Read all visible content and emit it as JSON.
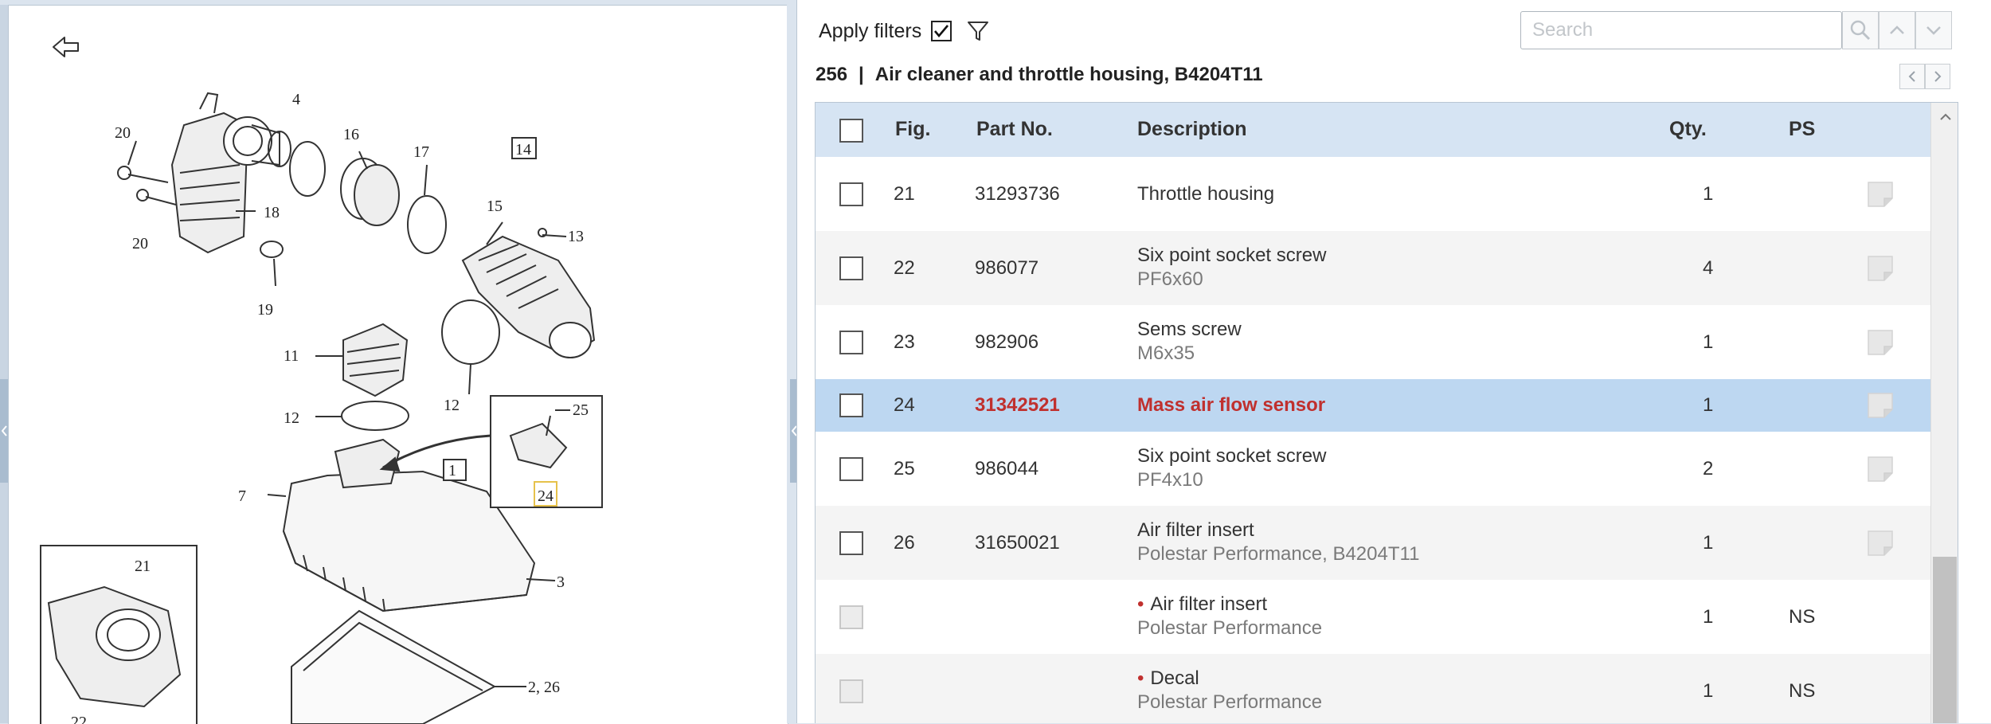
{
  "filters": {
    "label": "Apply filters",
    "checked": true
  },
  "search": {
    "placeholder": "Search"
  },
  "section": {
    "number": "256",
    "separator": "|",
    "title": "Air cleaner and throttle housing, B4204T11"
  },
  "table": {
    "headers": {
      "fig": "Fig.",
      "part_no": "Part No.",
      "description": "Description",
      "qty": "Qty.",
      "ps": "PS"
    },
    "rows": [
      {
        "fig": "21",
        "part_no": "31293736",
        "desc": "Throttle housing",
        "sub": "",
        "qty": "1",
        "ps": "",
        "selected": false,
        "child": false
      },
      {
        "fig": "22",
        "part_no": "986077",
        "desc": "Six point socket screw",
        "sub": "PF6x60",
        "qty": "4",
        "ps": "",
        "selected": false,
        "child": false
      },
      {
        "fig": "23",
        "part_no": "982906",
        "desc": "Sems screw",
        "sub": "M6x35",
        "qty": "1",
        "ps": "",
        "selected": false,
        "child": false
      },
      {
        "fig": "24",
        "part_no": "31342521",
        "desc": "Mass air flow sensor",
        "sub": "",
        "qty": "1",
        "ps": "",
        "selected": true,
        "child": false
      },
      {
        "fig": "25",
        "part_no": "986044",
        "desc": "Six point socket screw",
        "sub": "PF4x10",
        "qty": "2",
        "ps": "",
        "selected": false,
        "child": false
      },
      {
        "fig": "26",
        "part_no": "31650021",
        "desc": "Air filter insert",
        "sub": "Polestar Performance, B4204T11",
        "qty": "1",
        "ps": "",
        "selected": false,
        "child": false
      },
      {
        "fig": "",
        "part_no": "",
        "desc": "Air filter insert",
        "sub": "Polestar Performance",
        "qty": "1",
        "ps": "NS",
        "selected": false,
        "child": true
      },
      {
        "fig": "",
        "part_no": "",
        "desc": "Decal",
        "sub": "Polestar Performance",
        "qty": "1",
        "ps": "NS",
        "selected": false,
        "child": true
      }
    ]
  },
  "diagram": {
    "labels": [
      "20",
      "20",
      "18",
      "19",
      "16",
      "17",
      "14",
      "15",
      "13",
      "11",
      "12",
      "12",
      "25",
      "1",
      "24",
      "7",
      "3",
      "21",
      "2, 26",
      "22",
      "4"
    ]
  },
  "colors": {
    "accent_red": "#c0302e",
    "header_blue": "#d6e4f3",
    "selected_row": "#bdd7f1"
  }
}
